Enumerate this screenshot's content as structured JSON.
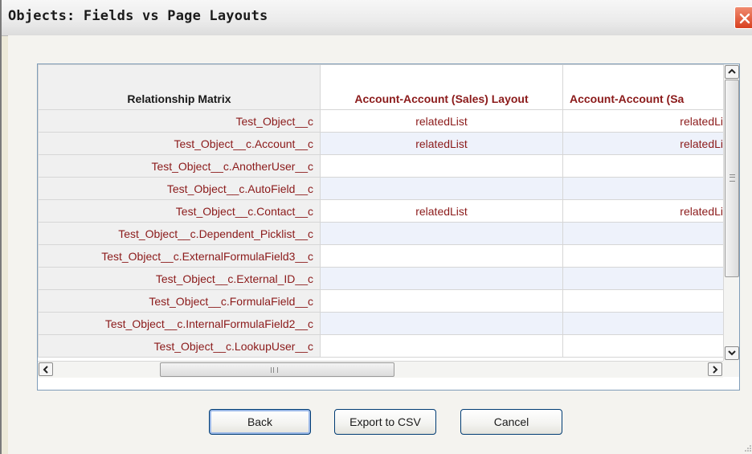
{
  "window": {
    "title": "Objects: Fields vs Page Layouts"
  },
  "matrix": {
    "corner_label": "Relationship Matrix",
    "columns": [
      "Account-Account (Sales) Layout",
      "Account-Account (Sa"
    ],
    "rows": [
      {
        "field": "Test_Object__c",
        "values": [
          "relatedList",
          "relatedLi"
        ]
      },
      {
        "field": "Test_Object__c.Account__c",
        "values": [
          "relatedList",
          "relatedLi"
        ]
      },
      {
        "field": "Test_Object__c.AnotherUser__c",
        "values": [
          "",
          ""
        ]
      },
      {
        "field": "Test_Object__c.AutoField__c",
        "values": [
          "",
          ""
        ]
      },
      {
        "field": "Test_Object__c.Contact__c",
        "values": [
          "relatedList",
          "relatedLi"
        ]
      },
      {
        "field": "Test_Object__c.Dependent_Picklist__c",
        "values": [
          "",
          ""
        ]
      },
      {
        "field": "Test_Object__c.ExternalFormulaField3__c",
        "values": [
          "",
          ""
        ]
      },
      {
        "field": "Test_Object__c.External_ID__c",
        "values": [
          "",
          ""
        ]
      },
      {
        "field": "Test_Object__c.FormulaField__c",
        "values": [
          "",
          ""
        ]
      },
      {
        "field": "Test_Object__c.InternalFormulaField2__c",
        "values": [
          "",
          ""
        ]
      },
      {
        "field": "Test_Object__c.LookupUser__c",
        "values": [
          "",
          ""
        ]
      }
    ]
  },
  "buttons": {
    "back": "Back",
    "export": "Export to CSV",
    "cancel": "Cancel"
  },
  "colors": {
    "field_text": "#8b1a1a",
    "close_button": "#d8401f",
    "alt_row": "#eef2fb"
  }
}
